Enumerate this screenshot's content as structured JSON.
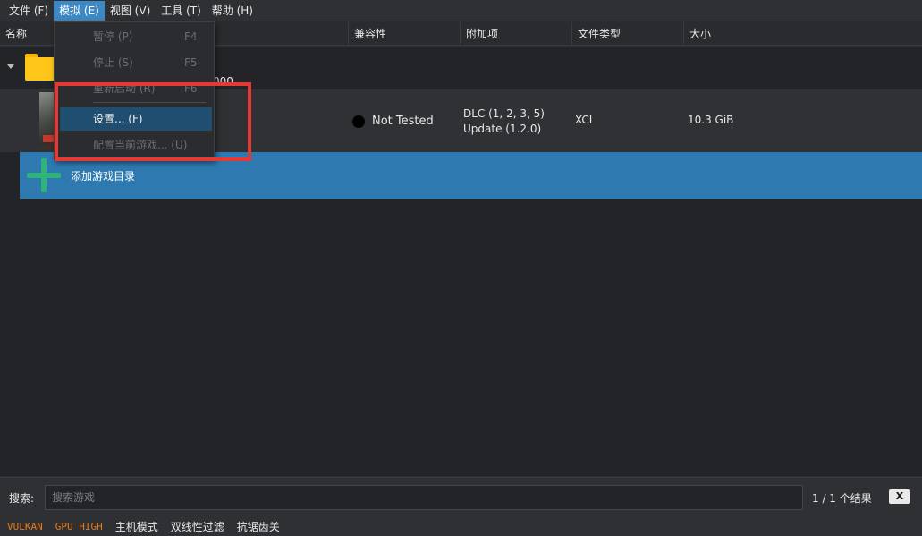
{
  "menubar": {
    "items": [
      {
        "label": "文件 (F)"
      },
      {
        "label": "模拟 (E)"
      },
      {
        "label": "视图 (V)"
      },
      {
        "label": "工具 (T)"
      },
      {
        "label": "帮助 (H)"
      }
    ]
  },
  "columns": [
    "名称",
    "兼容性",
    "附加项",
    "文件类型",
    "大小"
  ],
  "game": {
    "name_tail": "000",
    "compatibility": "Not Tested",
    "addons_line1": "DLC (1, 2, 3, 5)",
    "addons_line2": "Update (1.2.0)",
    "file_type": "XCI",
    "size": "10.3 GiB"
  },
  "add_dir": {
    "label": "添加游戏目录"
  },
  "emulation_menu": {
    "items": [
      {
        "label": "暂停 (P)",
        "shortcut": "F4",
        "enabled": false
      },
      {
        "label": "停止 (S)",
        "shortcut": "F5",
        "enabled": false
      },
      {
        "label": "重新启动 (R)",
        "shortcut": "F6",
        "enabled": false
      },
      {
        "label": "设置... (F)",
        "shortcut": "",
        "enabled": true
      },
      {
        "label": "配置当前游戏... (U)",
        "shortcut": "",
        "enabled": false
      }
    ]
  },
  "search": {
    "label": "搜索:",
    "placeholder": "搜索游戏",
    "results": "1 / 1 个结果",
    "clear_label": "X"
  },
  "status": {
    "renderer": "VULKAN",
    "gpu_accuracy": "GPU HIGH",
    "docked_mode": "主机模式",
    "filter": "双线性过滤",
    "antialiasing": "抗锯齿关"
  },
  "colors": {
    "accent": "#3c89c6",
    "add_row": "#2e7ab0",
    "highlight_box": "#e53935",
    "status_orange": "#e07b1f"
  }
}
